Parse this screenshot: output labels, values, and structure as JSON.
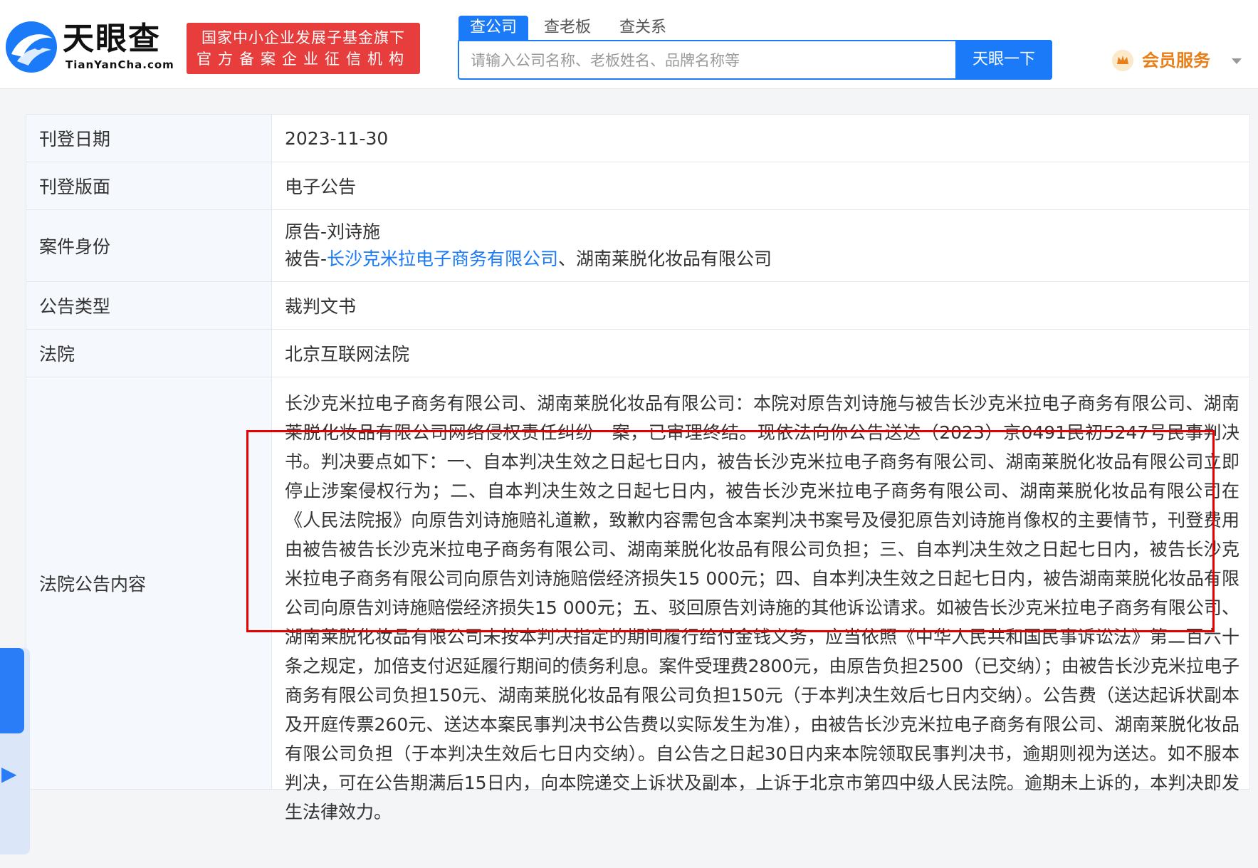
{
  "header": {
    "logo_cn": "天眼查",
    "logo_en": "TianYanCha.com",
    "badge_line1": "国家中小企业发展子基金旗下",
    "badge_line2": "官方备案企业征信机构",
    "tabs": [
      {
        "label": "查公司",
        "active": true
      },
      {
        "label": "查老板",
        "active": false
      },
      {
        "label": "查关系",
        "active": false
      }
    ],
    "search_placeholder": "请输入公司名称、老板姓名、品牌名称等",
    "search_button": "天眼一下",
    "vip_label": "会员服务",
    "colors": {
      "accent": "#1a7af8",
      "badge": "#e83d3d",
      "vip": "#e8801a"
    }
  },
  "details": {
    "publish_date": {
      "label": "刊登日期",
      "value": "2023-11-30"
    },
    "publish_section": {
      "label": "刊登版面",
      "value": "电子公告"
    },
    "case_identity": {
      "label": "案件身份",
      "plaintiff_line": "原告-刘诗施",
      "defendant_prefix": "被告-",
      "defendant_link": "长沙克米拉电子商务有限公司",
      "defendant_rest": "、湖南莱脱化妆品有限公司"
    },
    "notice_type": {
      "label": "公告类型",
      "value": "裁判文书"
    },
    "court": {
      "label": "法院",
      "value": "北京互联网法院"
    },
    "content": {
      "label": "法院公告内容",
      "text": "长沙克米拉电子商务有限公司、湖南莱脱化妆品有限公司：本院对原告刘诗施与被告长沙克米拉电子商务有限公司、湖南莱脱化妆品有限公司网络侵权责任纠纷一案，已审理终结。现依法向你公告送达（2023）京0491民初5247号民事判决书。判决要点如下：一、自本判决生效之日起七日内，被告长沙克米拉电子商务有限公司、湖南莱脱化妆品有限公司立即停止涉案侵权行为；二、自本判决生效之日起七日内，被告长沙克米拉电子商务有限公司、湖南莱脱化妆品有限公司在《人民法院报》向原告刘诗施赔礼道歉，致歉内容需包含本案判决书案号及侵犯原告刘诗施肖像权的主要情节，刊登费用由被告被告长沙克米拉电子商务有限公司、湖南莱脱化妆品有限公司负担；三、自本判决生效之日起七日内，被告长沙克米拉电子商务有限公司向原告刘诗施赔偿经济损失15 000元；四、自本判决生效之日起七日内，被告湖南莱脱化妆品有限公司向原告刘诗施赔偿经济损失15 000元；五、驳回原告刘诗施的其他诉讼请求。如被告长沙克米拉电子商务有限公司、湖南莱脱化妆品有限公司未按本判决指定的期间履行给付金钱义务，应当依照《中华人民共和国民事诉讼法》第二百六十条之规定，加倍支付迟延履行期间的债务利息。案件受理费2800元，由原告负担2500（已交纳）；由被告长沙克米拉电子商务有限公司负担150元、湖南莱脱化妆品有限公司负担150元（于本判决生效后七日内交纳）。公告费（送达起诉状副本及开庭传票260元、送达本案民事判决书公告费以实际发生为准），由被告长沙克米拉电子商务有限公司、湖南莱脱化妆品有限公司负担（于本判决生效后七日内交纳）。自公告之日起30日内来本院领取民事判决书，逾期则视为送达。如不服本判决，可在公告期满后15日内，向本院递交上诉状及副本，上诉于北京市第四中级人民法院。逾期未上诉的，本判决即发生法律效力。"
    }
  }
}
